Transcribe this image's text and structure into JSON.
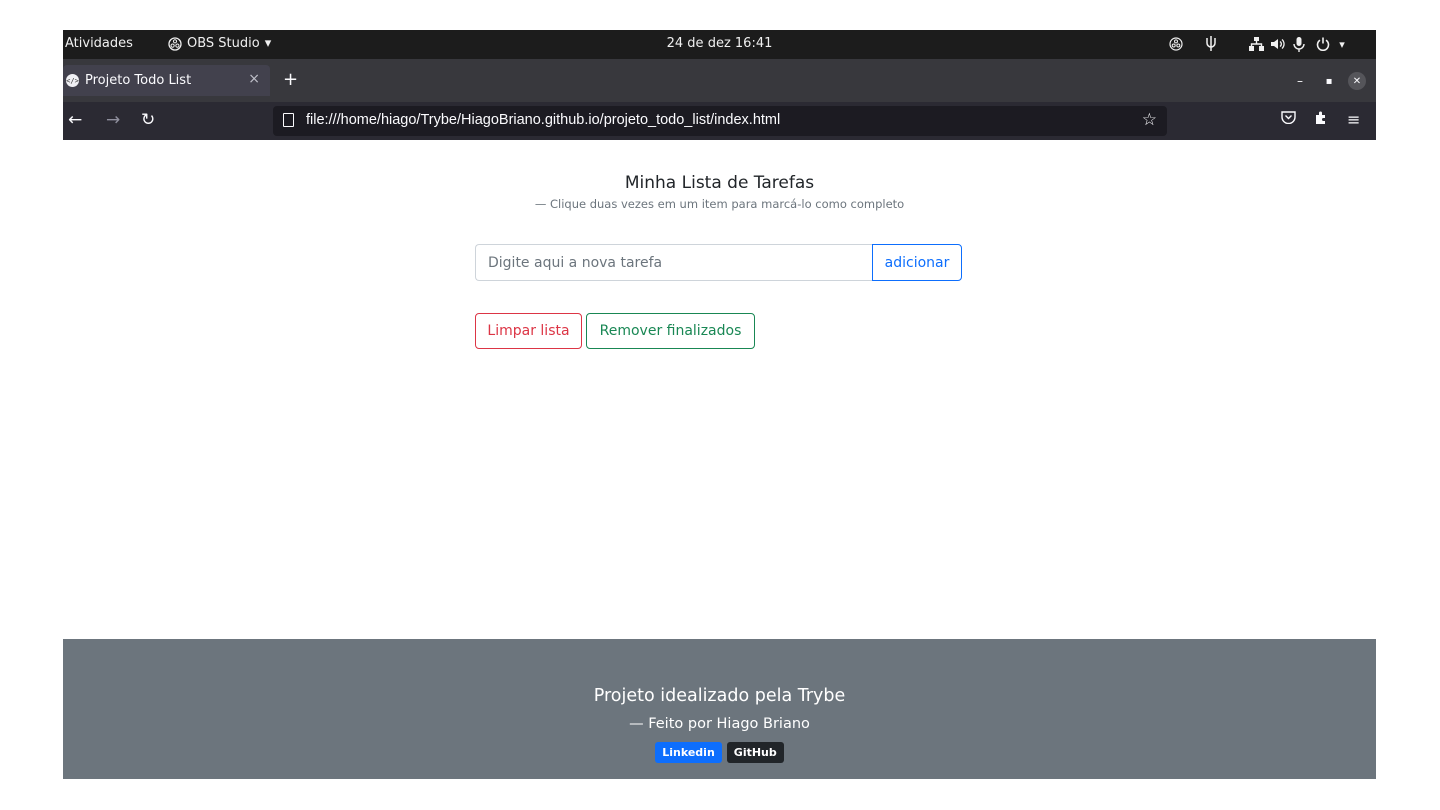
{
  "system_bar": {
    "activities": "Atividades",
    "app_name": "OBS Studio",
    "clock": "24 de dez  16:41"
  },
  "browser": {
    "tab_title": "Projeto Todo List",
    "tab_close": "×",
    "new_tab": "+",
    "url": "file:///home/hiago/Trybe/HiagoBriano.github.io/projeto_todo_list/index.html",
    "window_controls": {
      "minimize": "–",
      "maximize": "▪",
      "close": "✕"
    },
    "nav": {
      "back": "←",
      "forward": "→",
      "reload": "↻",
      "star": "☆"
    }
  },
  "page": {
    "title": "Minha Lista de Tarefas",
    "subtitle": "— Clique duas vezes em um item para marcá-lo como completo",
    "input_placeholder": "Digite aqui a nova tarefa",
    "add_button": "adicionar",
    "clear_button": "Limpar lista",
    "remove_done_button": "Remover finalizados",
    "tasks": []
  },
  "footer": {
    "title": "Projeto idealizado pela Trybe",
    "author": "— Feito por Hiago Briano",
    "links": [
      "Linkedin",
      "GitHub"
    ]
  },
  "colors": {
    "primary": "#0d6efd",
    "danger": "#dc3545",
    "success": "#198754",
    "footer_bg": "#6c757d"
  }
}
